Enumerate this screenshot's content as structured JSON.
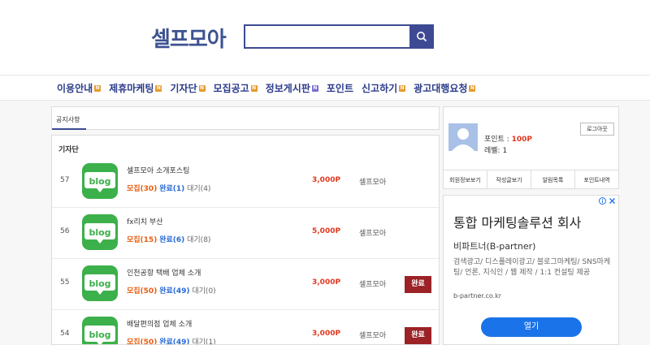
{
  "header": {
    "logo": "셀프모아",
    "search_placeholder": ""
  },
  "nav": [
    {
      "label": "이용안내",
      "badge": "N"
    },
    {
      "label": "제휴마케팅",
      "badge": "N"
    },
    {
      "label": "기자단",
      "badge": "N"
    },
    {
      "label": "모집공고",
      "badge": "N"
    },
    {
      "label": "정보게시판",
      "badge": "N"
    },
    {
      "label": "포인트",
      "badge": ""
    },
    {
      "label": "신고하기",
      "badge": "N"
    },
    {
      "label": "광고대행요청",
      "badge": "N"
    }
  ],
  "notice": {
    "tab": "공지사항"
  },
  "list": {
    "title": "기자단",
    "rows": [
      {
        "num": "57",
        "title": "셀프모아 소개포스팅",
        "recruit": "모집(30)",
        "done": "완료(1)",
        "wait": "대기(4)",
        "points": "3,000P",
        "author": "셀프모아",
        "status": ""
      },
      {
        "num": "56",
        "title": "fx리치 부산",
        "recruit": "모집(15)",
        "done": "완료(6)",
        "wait": "대기(8)",
        "points": "5,000P",
        "author": "셀프모아",
        "status": ""
      },
      {
        "num": "55",
        "title": "인천공항 택배 업체 소개",
        "recruit": "모집(50)",
        "done": "완료(49)",
        "wait": "대기(0)",
        "points": "3,000P",
        "author": "셀프모아",
        "status": "완료"
      },
      {
        "num": "54",
        "title": "배달편의점 업체 소개",
        "recruit": "모집(50)",
        "done": "완료(49)",
        "wait": "대기(1)",
        "points": "3,000P",
        "author": "셀프모아",
        "status": "완료"
      }
    ],
    "blog_label": "blog"
  },
  "user": {
    "points_label": "포인트 : ",
    "points_value": "100P",
    "level": "레벨: 1",
    "logout": "로그아웃",
    "menu": [
      "회원정보보기",
      "작성글보기",
      "알림목록",
      "포인트내역"
    ]
  },
  "ad": {
    "title": "통합 마케팅솔루션 회사",
    "sub": "비파트너(B-partner)",
    "desc": "검색광고/ 디스플레이광고/ 블로그마케팅/ SNS마케팅/ 언론, 지식인 / 웹 제작 / 1:1 컨설팅 제공",
    "url": "b-partner.co.kr",
    "open": "열기"
  },
  "colors": {
    "brand": "#3d5291",
    "blog_green": "#3cb04a",
    "complete_red": "#9b2226"
  }
}
